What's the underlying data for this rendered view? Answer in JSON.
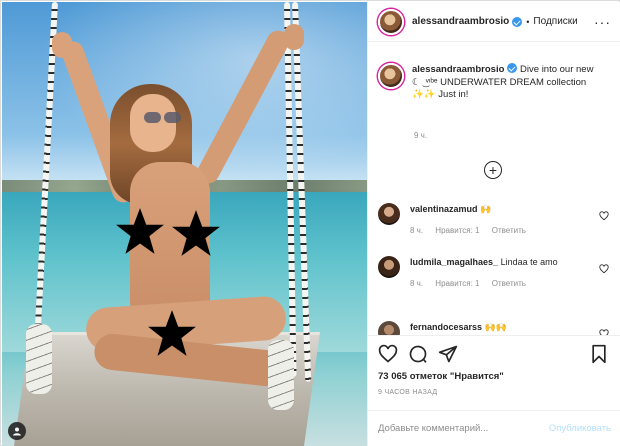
{
  "post": {
    "username": "alessandraambrosio",
    "follow_label": "Подписки",
    "separator": "•",
    "more_label": "···",
    "caption_text": "Dive into our new ☾ ͜ ᵛᶦᵇᵉ UNDERWATER DREAM collection ✨✨ Just in!",
    "caption_time": "9 ч.",
    "add_symbol": "+"
  },
  "comments": [
    {
      "username": "valentinazamud",
      "text": "🙌",
      "time": "8 ч.",
      "likes": "Нравится: 1",
      "reply": "Ответить"
    },
    {
      "username": "ludmila_magalhaes_",
      "text": "Lindaa te amo",
      "time": "8 ч.",
      "likes": "Нравится: 1",
      "reply": "Ответить"
    },
    {
      "username": "fernandocesarss",
      "text": "🙌🙌",
      "time": "",
      "likes": "",
      "reply": ""
    }
  ],
  "stats": {
    "likes_text": "73 065 отметок \"Нравится\"",
    "time_ago": "9 ЧАСОВ НАЗАД"
  },
  "composer": {
    "placeholder": "Добавьте комментарий...",
    "publish_label": "Опубликовать"
  },
  "icons": {
    "like": "heart-icon",
    "comment": "comment-icon",
    "share": "share-icon",
    "save": "bookmark-icon"
  },
  "colors": {
    "verified": "#3897f0",
    "publish_disabled": "#b2dffc",
    "meta_gray": "#8e8e8e"
  }
}
